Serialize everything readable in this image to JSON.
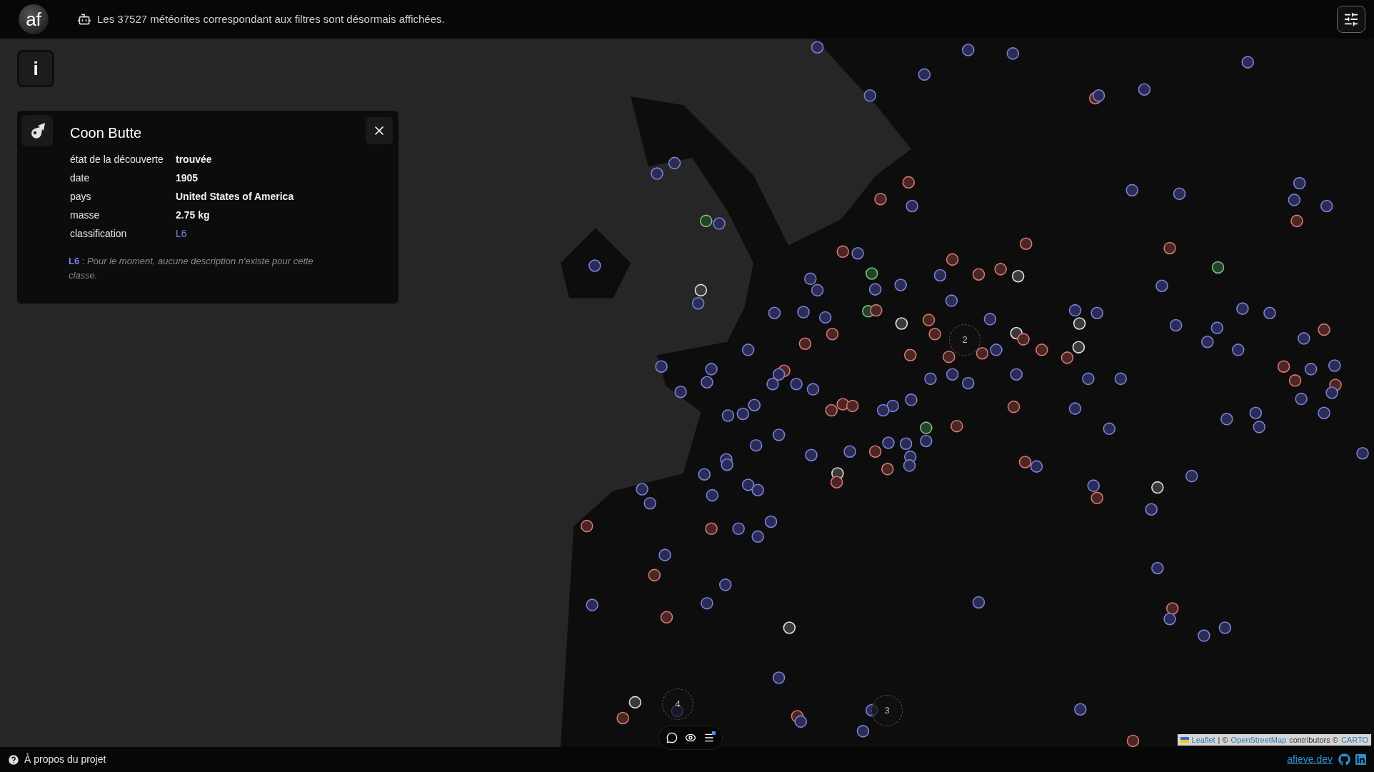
{
  "header": {
    "logo": "af",
    "message": "Les 37527 météorites correspondant aux filtres sont désormais affichées."
  },
  "info_button": {
    "label": "i"
  },
  "panel": {
    "title": "Coon Butte",
    "rows": [
      {
        "label": "état de la découverte",
        "value": "trouvée",
        "kind": "text"
      },
      {
        "label": "date",
        "value": "1905",
        "kind": "text"
      },
      {
        "label": "pays",
        "value": "United States of America",
        "kind": "text"
      },
      {
        "label": "masse",
        "value": "2.75 kg",
        "kind": "text"
      },
      {
        "label": "classification",
        "value": "L6",
        "kind": "link"
      }
    ],
    "description": "**L6** : *Pour le moment, aucune description n'existe pour cette classe.*"
  },
  "clusters": [
    {
      "label": "2"
    },
    {
      "label": "3"
    },
    {
      "label": "4"
    }
  ],
  "attribution": [
    {
      "kind": "link",
      "text": "Leaflet"
    },
    {
      "kind": "text",
      "text": "| ©"
    },
    {
      "kind": "link",
      "text": "OpenStreetMap"
    },
    {
      "kind": "text",
      "text": "contributors ©"
    },
    {
      "kind": "link",
      "text": "CARTO"
    }
  ],
  "footer": {
    "about": "À propos du projet",
    "site": "afieve.dev"
  }
}
